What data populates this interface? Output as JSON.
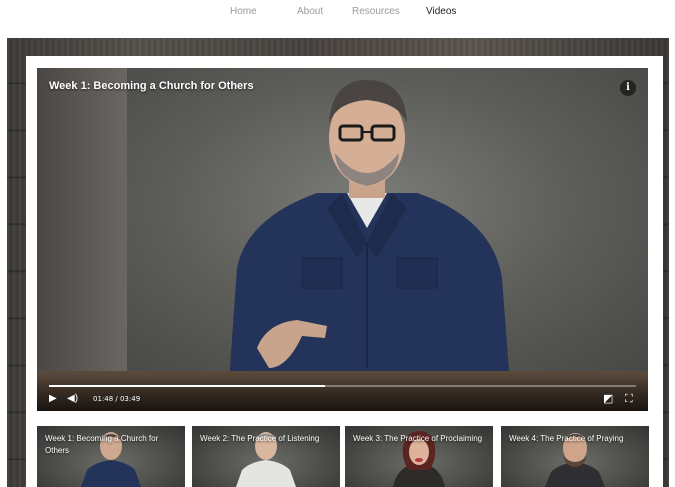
{
  "nav": {
    "items": [
      {
        "label": "Home"
      },
      {
        "label": "About"
      },
      {
        "label": "Resources"
      },
      {
        "label": "Videos"
      }
    ],
    "active": "Videos"
  },
  "player": {
    "title": "Week 1: Becoming a Church for Others",
    "info_icon": "info-icon",
    "time": "01:48 / 03:49",
    "progress_fraction": 0.47,
    "icons": [
      "play-icon",
      "volume-icon",
      "picture-in-picture-icon",
      "fullscreen-icon"
    ]
  },
  "playlist": [
    {
      "title": "Week 1: Becoming a Church for Others"
    },
    {
      "title": "Week 2: The Practice of Listening"
    },
    {
      "title": "Week 3: The Practice of Proclaiming"
    },
    {
      "title": "Week 4: The Practice of Praying"
    }
  ],
  "colors": {
    "nav_active": "#222222",
    "nav_inactive": "#9a9a9a",
    "wood": "#4a4541",
    "shirt": "#23335a"
  }
}
